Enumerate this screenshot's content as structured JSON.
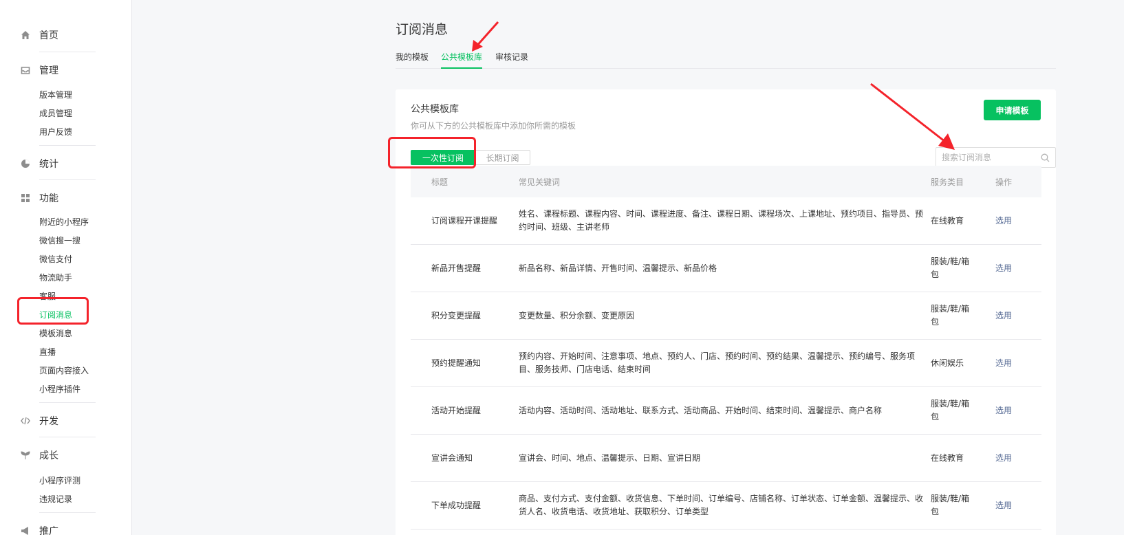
{
  "sidebar": {
    "home": "首页",
    "manage": {
      "label": "管理",
      "items": [
        "版本管理",
        "成员管理",
        "用户反馈"
      ]
    },
    "stats": "统计",
    "features": {
      "label": "功能",
      "items": [
        "附近的小程序",
        "微信搜一搜",
        "微信支付",
        "物流助手",
        "客服",
        "订阅消息",
        "模板消息",
        "直播",
        "页面内容接入",
        "小程序插件"
      ]
    },
    "dev": "开发",
    "growth": {
      "label": "成长",
      "items": [
        "小程序评测",
        "违规记录"
      ]
    },
    "promo": "推广",
    "active_item": "订阅消息",
    "icons": [
      "home-icon",
      "inbox-icon",
      "pie-chart-icon",
      "grid-icon",
      "code-icon",
      "sprout-icon",
      "megaphone-icon"
    ]
  },
  "header": {
    "title": "订阅消息",
    "tabs": [
      "我的模板",
      "公共模板库",
      "审核记录"
    ],
    "active_tab": "公共模板库"
  },
  "card": {
    "title": "公共模板库",
    "desc": "你可从下方的公共模板库中添加你所需的模板",
    "apply_label": "申请模板",
    "segments": [
      "一次性订阅",
      "长期订阅"
    ],
    "active_segment": "一次性订阅",
    "search_placeholder": "搜索订阅消息"
  },
  "table": {
    "headers": [
      "标题",
      "常见关键词",
      "服务类目",
      "操作"
    ],
    "rows": [
      {
        "title": "订阅课程开课提醒",
        "keywords": "姓名、课程标题、课程内容、时间、课程进度、备注、课程日期、课程场次、上课地址、预约项目、指导员、预约时间、班级、主讲老师",
        "category": "在线教育",
        "op": "选用"
      },
      {
        "title": "新品开售提醒",
        "keywords": "新品名称、新品详情、开售时间、温馨提示、新品价格",
        "category": "服装/鞋/箱包",
        "op": "选用"
      },
      {
        "title": "积分变更提醒",
        "keywords": "变更数量、积分余额、变更原因",
        "category": "服装/鞋/箱包",
        "op": "选用"
      },
      {
        "title": "预约提醒通知",
        "keywords": "预约内容、开始时间、注意事项、地点、预约人、门店、预约时间、预约结果、温馨提示、预约编号、服务项目、服务技师、门店电话、结束时间",
        "category": "休闲娱乐",
        "op": "选用"
      },
      {
        "title": "活动开始提醒",
        "keywords": "活动内容、活动时间、活动地址、联系方式、活动商品、开始时间、结束时间、温馨提示、商户名称",
        "category": "服装/鞋/箱包",
        "op": "选用"
      },
      {
        "title": "宣讲会通知",
        "keywords": "宣讲会、时间、地点、温馨提示、日期、宣讲日期",
        "category": "在线教育",
        "op": "选用"
      },
      {
        "title": "下单成功提醒",
        "keywords": "商品、支付方式、支付金额、收货信息、下单时间、订单编号、店铺名称、订单状态、订单金额、温馨提示、收货人名、收货电话、收货地址、获取积分、订单类型",
        "category": "服装/鞋/箱包",
        "op": "选用"
      }
    ]
  },
  "colors": {
    "brand": "#07c160",
    "link": "#576b95",
    "annotation": "#f4232b"
  }
}
